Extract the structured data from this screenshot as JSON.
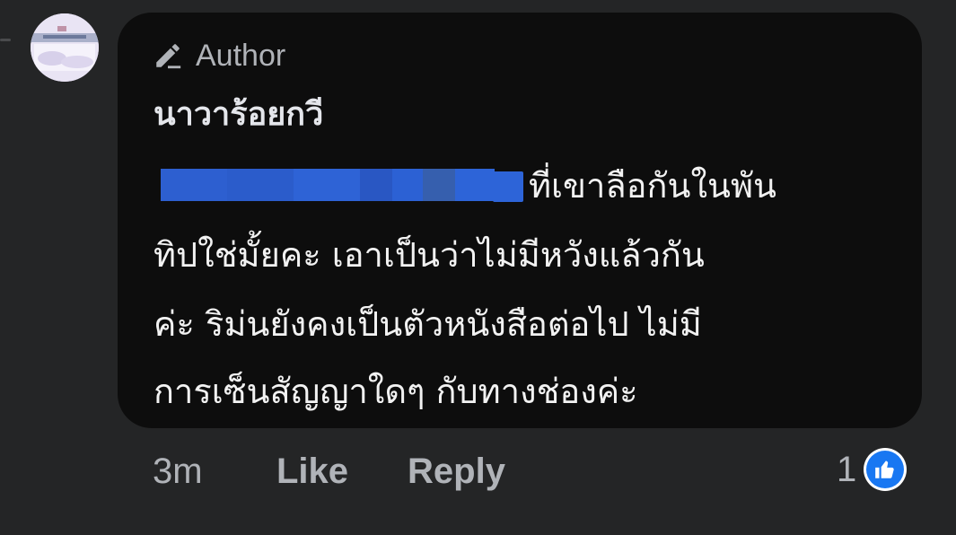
{
  "comment": {
    "author_badge": "Author",
    "commenter_name": "นาวาร้อยกวี",
    "text_lines": [
      "ที่เขาลือกันในพัน",
      "ทิปใช่มั้ยคะ เอาเป็นว่าไม่มีหวังแล้วกัน",
      "ค่ะ ริม่นยังคงเป็นตัวหนังสือต่อไป ไม่มี",
      "การเซ็นสัญญาใดๆ กับทางช่องค่ะ"
    ],
    "redaction_color": "#2d64d8"
  },
  "actions": {
    "timestamp": "3m",
    "like_label": "Like",
    "reply_label": "Reply"
  },
  "reactions": {
    "count": "1",
    "icon": "thumbs-up-icon",
    "color": "#1877f2"
  },
  "colors": {
    "background": "#242526",
    "bubble": "#0d0d0d",
    "secondary_text": "#b0b3b8",
    "primary_text": "#f2f2f2"
  }
}
